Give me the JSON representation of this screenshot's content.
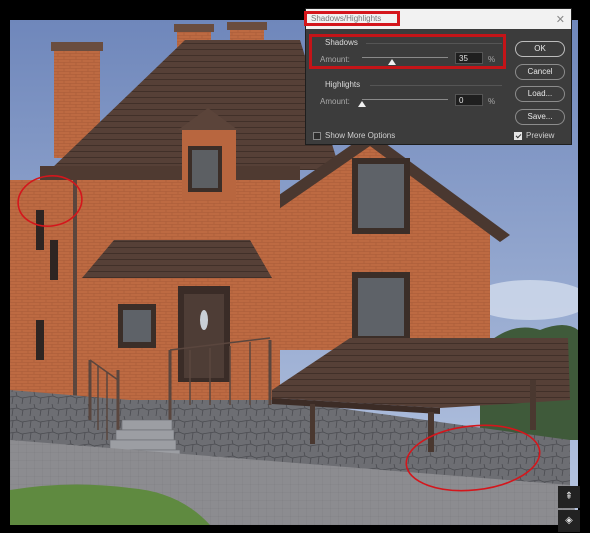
{
  "dialog": {
    "title": "Shadows/Highlights",
    "close_glyph": "✕",
    "shadows": {
      "heading": "Shadows",
      "amount_label": "Amount:",
      "value": "35",
      "unit": "%",
      "slider_level": 0.35
    },
    "highlights": {
      "heading": "Highlights",
      "amount_label": "Amount:",
      "value": "0",
      "unit": "%",
      "slider_level": 0.0
    },
    "buttons": {
      "ok": "OK",
      "cancel": "Cancel",
      "load": "Load...",
      "save": "Save..."
    },
    "show_more_options": {
      "label": "Show More Options",
      "checked": false
    },
    "preview": {
      "label": "Preview",
      "checked": true
    }
  },
  "annotations": {
    "highlight_color": "#d4161c",
    "marks": [
      "gutter-circle-top-left",
      "wall-circle-bottom-right",
      "title-box",
      "shadows-box"
    ]
  },
  "icons": {
    "top": "stamp-icon",
    "bottom": "layers-icon"
  },
  "colors": {
    "dialog_bg": "#3c3c3c",
    "brick": "#b8663f",
    "roof": "#4e3b32",
    "sky": "#8aa1c9"
  }
}
